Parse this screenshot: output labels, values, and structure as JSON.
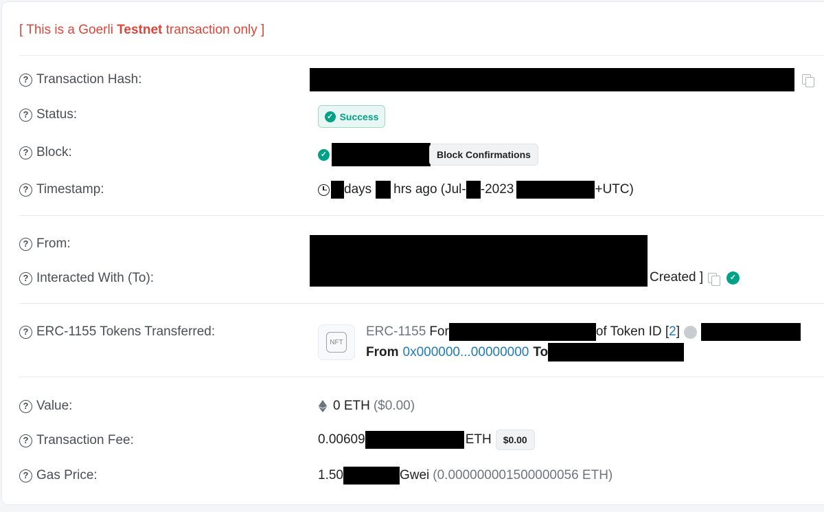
{
  "notice": {
    "prefix": "[ This is a Goerli ",
    "bold": "Testnet",
    "suffix": " transaction only ]"
  },
  "labels": {
    "tx_hash": "Transaction Hash:",
    "status": "Status:",
    "block": "Block:",
    "timestamp": "Timestamp:",
    "from": "From:",
    "to": "Interacted With (To):",
    "erc1155": "ERC-1155 Tokens Transferred:",
    "value": "Value:",
    "fee": "Transaction Fee:",
    "gas": "Gas Price:"
  },
  "status": {
    "text": "Success"
  },
  "block": {
    "confirmations_label": "Block Confirmations"
  },
  "timestamp": {
    "days": "days",
    "hrs_ago": "hrs ago (Jul-",
    "year": "-2023",
    "utc": "+UTC)"
  },
  "interacted": {
    "created": "Created ]"
  },
  "token_transfer": {
    "standard": "ERC-1155",
    "for": "For",
    "of_token_id": "of Token ID [",
    "token_id": "2",
    "close_bracket": "]",
    "from_label": "From",
    "from_address": "0x000000...00000000",
    "to_label": "To",
    "nft_label": "NFT"
  },
  "value": {
    "amount": "0 ETH",
    "usd": "($0.00)"
  },
  "fee": {
    "prefix": "0.00609",
    "unit": "ETH",
    "usd": "$0.00"
  },
  "gas": {
    "prefix": "1.50",
    "unit": "Gwei",
    "eth": "(0.000000001500000056 ETH)"
  },
  "icons": {
    "help": "question-circle-icon",
    "copy": "copy-icon",
    "check": "check-circle-icon",
    "clock": "clock-icon",
    "eth": "ethereum-icon"
  },
  "colors": {
    "success": "#00a186",
    "danger": "#de4437",
    "link": "#1e7ab8"
  }
}
